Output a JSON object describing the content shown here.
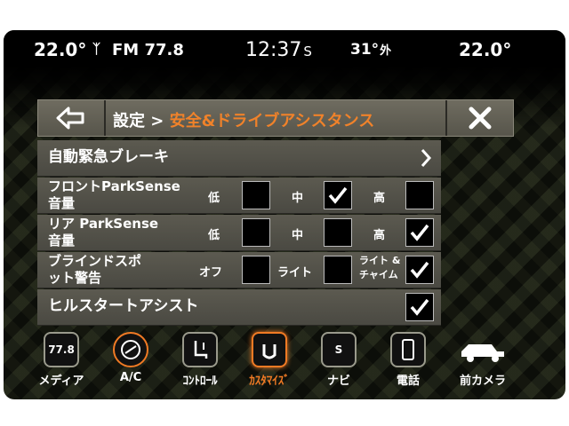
{
  "status": {
    "temp_left": "22.0°",
    "radio": "FM 77.8",
    "time": "12:37",
    "time_suffix": "S",
    "outside_temp": "31°",
    "outside_label": "外",
    "temp_right": "22.0°"
  },
  "header": {
    "breadcrumb_root": "設定",
    "separator": ">",
    "current": "安全&ドライブアシスタンス"
  },
  "rows": {
    "aeb": {
      "label": "自動緊急ブレーキ"
    },
    "front_parksense": {
      "label_line1": "フロントParkSense",
      "label_line2": "音量",
      "opt_low": "低",
      "opt_mid": "中",
      "opt_high": "高",
      "selected": "中"
    },
    "rear_parksense": {
      "label_line1": "リア ParkSense",
      "label_line2": "音量",
      "opt_low": "低",
      "opt_mid": "中",
      "opt_high": "高",
      "selected": "高"
    },
    "blind_spot": {
      "label_line1": "ブラインドスポ",
      "label_line2": "ット警告",
      "opt_off": "オフ",
      "opt_light": "ライト",
      "opt_chime_line1": "ライト &",
      "opt_chime_line2": "チャイム",
      "selected": "ライト & チャイム"
    },
    "hill_start": {
      "label": "ヒルスタートアシスト",
      "checked": true
    }
  },
  "nav": [
    {
      "label": "メディア",
      "icon": "media-icon",
      "icon_text": "77.8"
    },
    {
      "label": "A/C",
      "icon": "climate-icon"
    },
    {
      "label": "ｺﾝﾄﾛｰﾙ",
      "icon": "seat-control-icon"
    },
    {
      "label": "ｶｽﾀﾏｲｽﾞ",
      "icon": "customize-icon",
      "active": true
    },
    {
      "label": "ナビ",
      "icon": "navigation-icon",
      "icon_text": "S"
    },
    {
      "label": "電話",
      "icon": "phone-icon"
    },
    {
      "label": "前カメラ",
      "icon": "front-camera-icon"
    }
  ],
  "colors": {
    "accent": "#f07a24",
    "text": "#ffffff",
    "row_bg": "#54534a"
  }
}
